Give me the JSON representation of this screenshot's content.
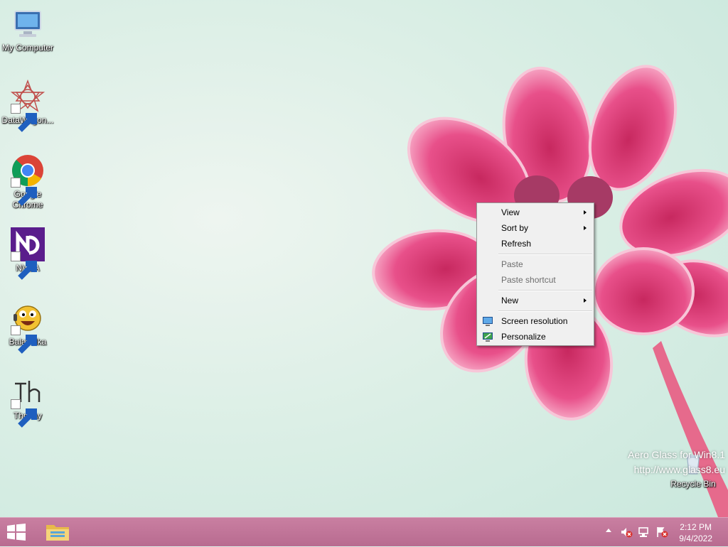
{
  "desktop": {
    "icons": [
      {
        "label": "My Computer",
        "icon": "computer-icon"
      },
      {
        "label": "DataWagon...",
        "icon": "datawagon-icon"
      },
      {
        "label": "Google Chrome",
        "icon": "chrome-icon"
      },
      {
        "label": "NVDA",
        "icon": "nvda-icon"
      },
      {
        "label": "Balabolka",
        "icon": "balabolka-icon"
      },
      {
        "label": "Thonny",
        "icon": "thonny-icon"
      },
      {
        "label": "Recycle Bin",
        "icon": "recycle-bin-icon"
      }
    ],
    "watermark": {
      "line1": "Aero Glass for Win8.1",
      "line2": "http://www.glass8.eu"
    }
  },
  "context_menu": {
    "view": "View",
    "sort_by": "Sort by",
    "refresh": "Refresh",
    "paste": "Paste",
    "paste_shortcut": "Paste shortcut",
    "new": "New",
    "screen_resolution": "Screen resolution",
    "personalize": "Personalize"
  },
  "taskbar": {
    "time": "2:12 PM",
    "date": "9/4/2022"
  },
  "colors": {
    "taskbar": "#b86b90",
    "flower": "#e0457f"
  }
}
